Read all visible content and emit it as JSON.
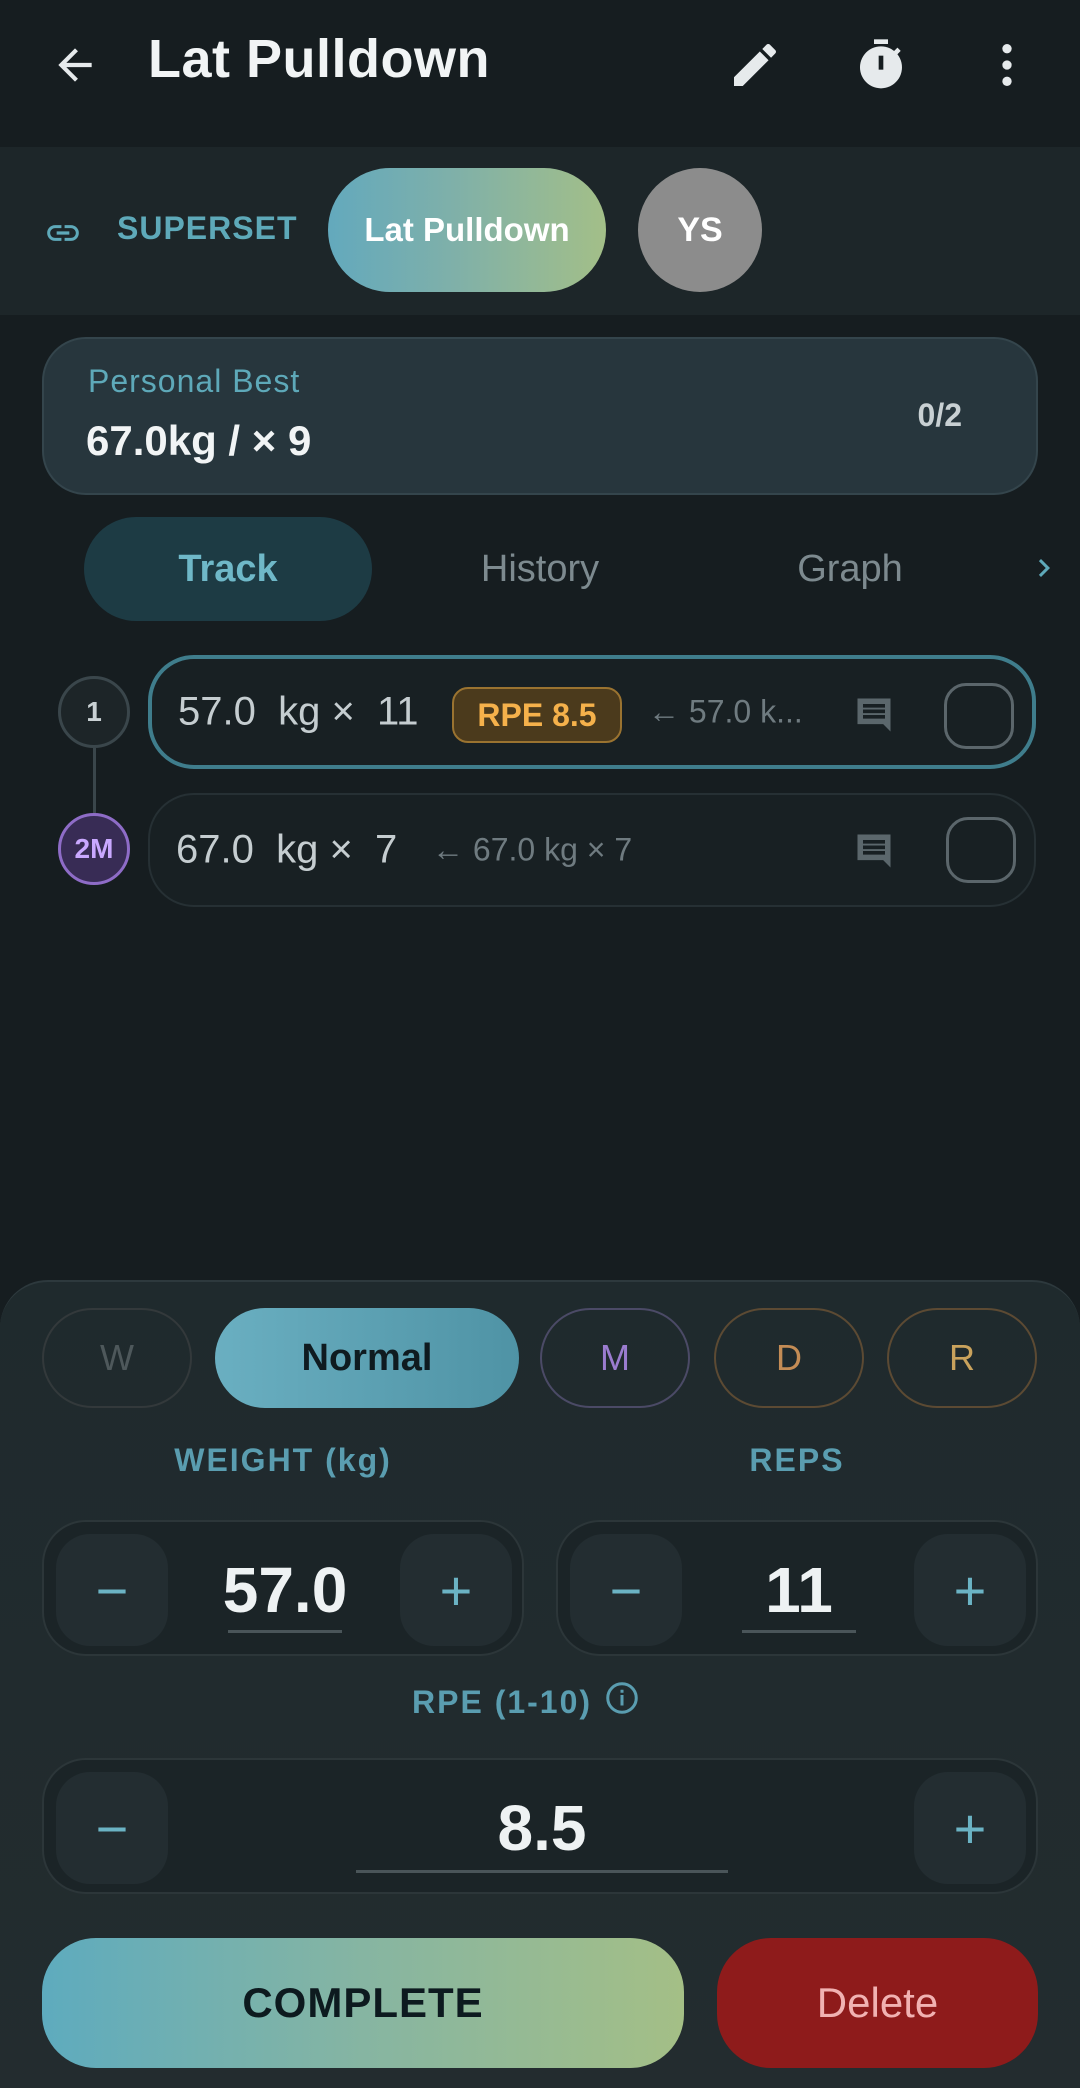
{
  "app_bar": {
    "title": "Lat Pulldown",
    "icons": [
      "back-arrow-icon",
      "edit-pencil-icon",
      "stopwatch-icon",
      "more-vert-icon"
    ]
  },
  "superset": {
    "label": "SUPERSET",
    "active_exercise": "Lat Pulldown",
    "other_exercise_initials": "YS"
  },
  "personal_best": {
    "label": "Personal Best",
    "value": "67.0kg / × 9",
    "sets_progress": "0/2"
  },
  "tabs": [
    {
      "label": "Track",
      "active": true
    },
    {
      "label": "History",
      "active": false
    },
    {
      "label": "Graph",
      "active": false
    }
  ],
  "sets": [
    {
      "number": "1",
      "main": "57.0  kg ×  11",
      "rpe_badge": "RPE 8.5",
      "previous": "← 57.0 k...",
      "completed": false
    },
    {
      "number": "2M",
      "main": "67.0  kg ×  7",
      "previous": "← 67.0 kg × 7",
      "completed": false
    }
  ],
  "set_types": [
    {
      "label": "W",
      "selected": false
    },
    {
      "label": "Normal",
      "selected": true
    },
    {
      "label": "M",
      "selected": false
    },
    {
      "label": "D",
      "selected": false
    },
    {
      "label": "R",
      "selected": false
    }
  ],
  "inputs": {
    "weight_label": "WEIGHT (kg)",
    "weight_value": "57.0",
    "reps_label": "REPS",
    "reps_value": "11",
    "rpe_label": "RPE (1-10)",
    "rpe_value": "8.5",
    "minus": "−",
    "plus": "+"
  },
  "actions": {
    "complete": "COMPLETE",
    "delete": "Delete"
  },
  "colors": {
    "accent": "#5ea9b9",
    "rpe_badge": "#f5b14b",
    "mode_m": "#9b7ccf",
    "delete": "#8e1b1b"
  }
}
